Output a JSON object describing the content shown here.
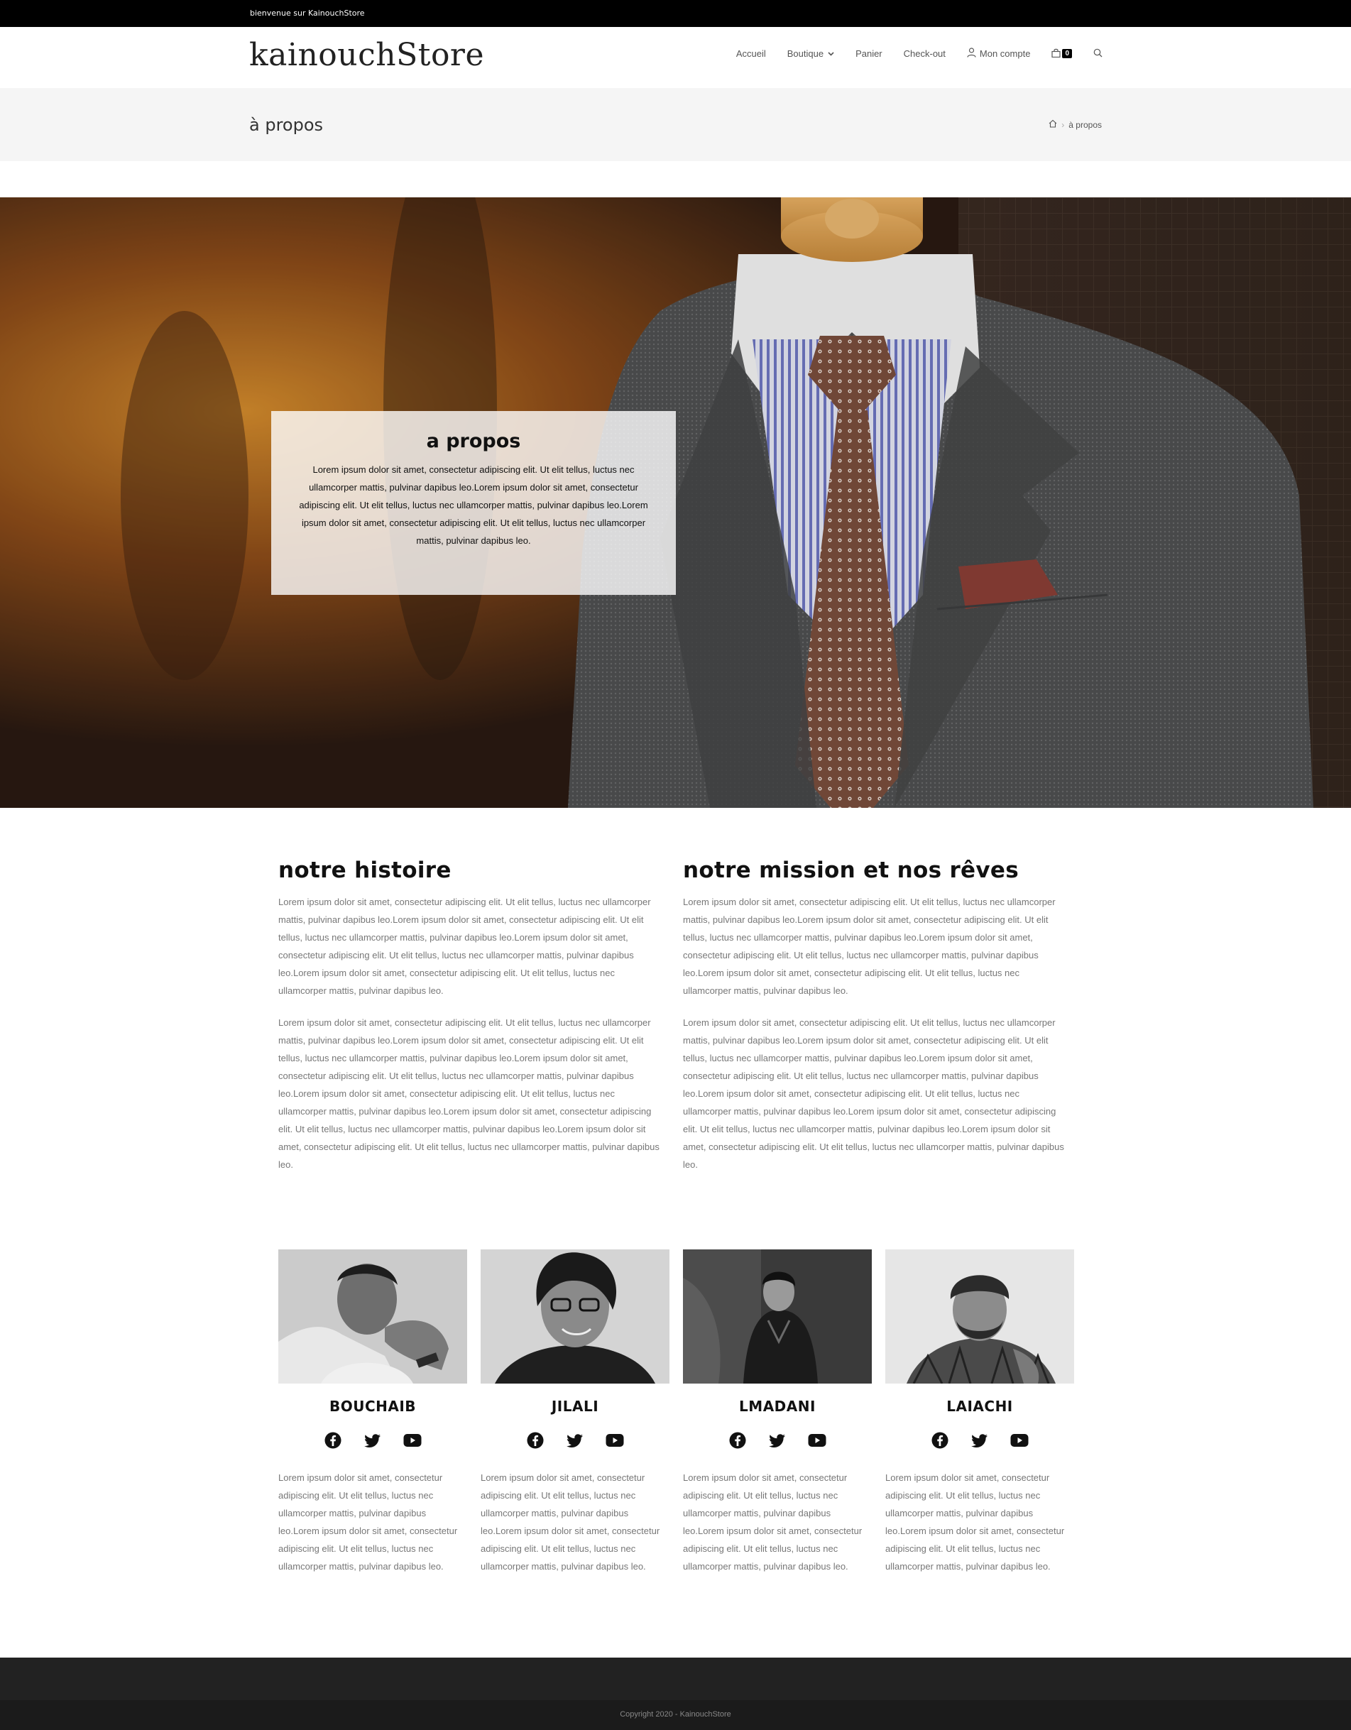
{
  "topbar": {
    "welcome": "bienvenue sur KainouchStore"
  },
  "header": {
    "logo": "kainouchStore",
    "nav": [
      {
        "label": "Accueil"
      },
      {
        "label": "Boutique"
      },
      {
        "label": "Panier"
      },
      {
        "label": "Check-out"
      },
      {
        "label": "Mon compte"
      }
    ],
    "cart_count": "0"
  },
  "page_header": {
    "title": "à propos",
    "breadcrumb_current": "à propos"
  },
  "hero": {
    "title": "a propos",
    "text": "Lorem ipsum dolor sit amet, consectetur adipiscing elit. Ut elit tellus, luctus nec ullamcorper mattis, pulvinar dapibus leo.Lorem ipsum dolor sit amet, consectetur adipiscing elit. Ut elit tellus, luctus nec ullamcorper mattis, pulvinar dapibus leo.Lorem ipsum dolor sit amet, consectetur adipiscing elit. Ut elit tellus, luctus nec ullamcorper mattis, pulvinar dapibus leo."
  },
  "history": {
    "title": "notre histoire",
    "p1": "Lorem ipsum dolor sit amet, consectetur adipiscing elit. Ut elit tellus, luctus nec ullamcorper mattis, pulvinar dapibus leo.Lorem ipsum dolor sit amet, consectetur adipiscing elit. Ut elit tellus, luctus nec ullamcorper mattis, pulvinar dapibus leo.Lorem ipsum dolor sit amet, consectetur adipiscing elit. Ut elit tellus, luctus nec ullamcorper mattis, pulvinar dapibus leo.Lorem ipsum dolor sit amet, consectetur adipiscing elit. Ut elit tellus, luctus nec ullamcorper mattis, pulvinar dapibus leo.",
    "p2": "Lorem ipsum dolor sit amet, consectetur adipiscing elit. Ut elit tellus, luctus nec ullamcorper mattis, pulvinar dapibus leo.Lorem ipsum dolor sit amet, consectetur adipiscing elit. Ut elit tellus, luctus nec ullamcorper mattis, pulvinar dapibus leo.Lorem ipsum dolor sit amet, consectetur adipiscing elit. Ut elit tellus, luctus nec ullamcorper mattis, pulvinar dapibus leo.Lorem ipsum dolor sit amet, consectetur adipiscing elit. Ut elit tellus, luctus nec ullamcorper mattis, pulvinar dapibus leo.Lorem ipsum dolor sit amet, consectetur adipiscing elit. Ut elit tellus, luctus nec ullamcorper mattis, pulvinar dapibus leo.Lorem ipsum dolor sit amet, consectetur adipiscing elit. Ut elit tellus, luctus nec ullamcorper mattis, pulvinar dapibus leo."
  },
  "mission": {
    "title": "notre mission et nos rêves",
    "p1": "Lorem ipsum dolor sit amet, consectetur adipiscing elit. Ut elit tellus, luctus nec ullamcorper mattis, pulvinar dapibus leo.Lorem ipsum dolor sit amet, consectetur adipiscing elit. Ut elit tellus, luctus nec ullamcorper mattis, pulvinar dapibus leo.Lorem ipsum dolor sit amet, consectetur adipiscing elit. Ut elit tellus, luctus nec ullamcorper mattis, pulvinar dapibus leo.Lorem ipsum dolor sit amet, consectetur adipiscing elit. Ut elit tellus, luctus nec ullamcorper mattis, pulvinar dapibus leo.",
    "p2": "Lorem ipsum dolor sit amet, consectetur adipiscing elit. Ut elit tellus, luctus nec ullamcorper mattis, pulvinar dapibus leo.Lorem ipsum dolor sit amet, consectetur adipiscing elit. Ut elit tellus, luctus nec ullamcorper mattis, pulvinar dapibus leo.Lorem ipsum dolor sit amet, consectetur adipiscing elit. Ut elit tellus, luctus nec ullamcorper mattis, pulvinar dapibus leo.Lorem ipsum dolor sit amet, consectetur adipiscing elit. Ut elit tellus, luctus nec ullamcorper mattis, pulvinar dapibus leo.Lorem ipsum dolor sit amet, consectetur adipiscing elit. Ut elit tellus, luctus nec ullamcorper mattis, pulvinar dapibus leo.Lorem ipsum dolor sit amet, consectetur adipiscing elit. Ut elit tellus, luctus nec ullamcorper mattis, pulvinar dapibus leo."
  },
  "team": [
    {
      "name": "BOUCHAIB",
      "text": "Lorem ipsum dolor sit amet, consectetur adipiscing elit. Ut elit tellus, luctus nec ullamcorper mattis, pulvinar dapibus leo.Lorem ipsum dolor sit amet, consectetur adipiscing elit. Ut elit tellus, luctus nec ullamcorper mattis, pulvinar dapibus leo."
    },
    {
      "name": "JILALI",
      "text": "Lorem ipsum dolor sit amet, consectetur adipiscing elit. Ut elit tellus, luctus nec ullamcorper mattis, pulvinar dapibus leo.Lorem ipsum dolor sit amet, consectetur adipiscing elit. Ut elit tellus, luctus nec ullamcorper mattis, pulvinar dapibus leo."
    },
    {
      "name": "LMADANI",
      "text": "Lorem ipsum dolor sit amet, consectetur adipiscing elit. Ut elit tellus, luctus nec ullamcorper mattis, pulvinar dapibus leo.Lorem ipsum dolor sit amet, consectetur adipiscing elit. Ut elit tellus, luctus nec ullamcorper mattis, pulvinar dapibus leo."
    },
    {
      "name": "LAIACHI",
      "text": "Lorem ipsum dolor sit amet, consectetur adipiscing elit. Ut elit tellus, luctus nec ullamcorper mattis, pulvinar dapibus leo.Lorem ipsum dolor sit amet, consectetur adipiscing elit. Ut elit tellus, luctus nec ullamcorper mattis, pulvinar dapibus leo."
    }
  ],
  "icons": {
    "social": [
      "facebook-icon",
      "twitter-icon",
      "youtube-icon"
    ],
    "header": [
      "chevron-down-icon",
      "user-icon",
      "shopping-bag-icon",
      "search-icon",
      "home-icon"
    ]
  },
  "colors": {
    "topbar": "#000000",
    "page_header_bg": "#f5f5f5",
    "footer": "#222222",
    "body_text": "#777777"
  },
  "footer": {
    "copyright": "Copyright 2020 - KainouchStore"
  }
}
